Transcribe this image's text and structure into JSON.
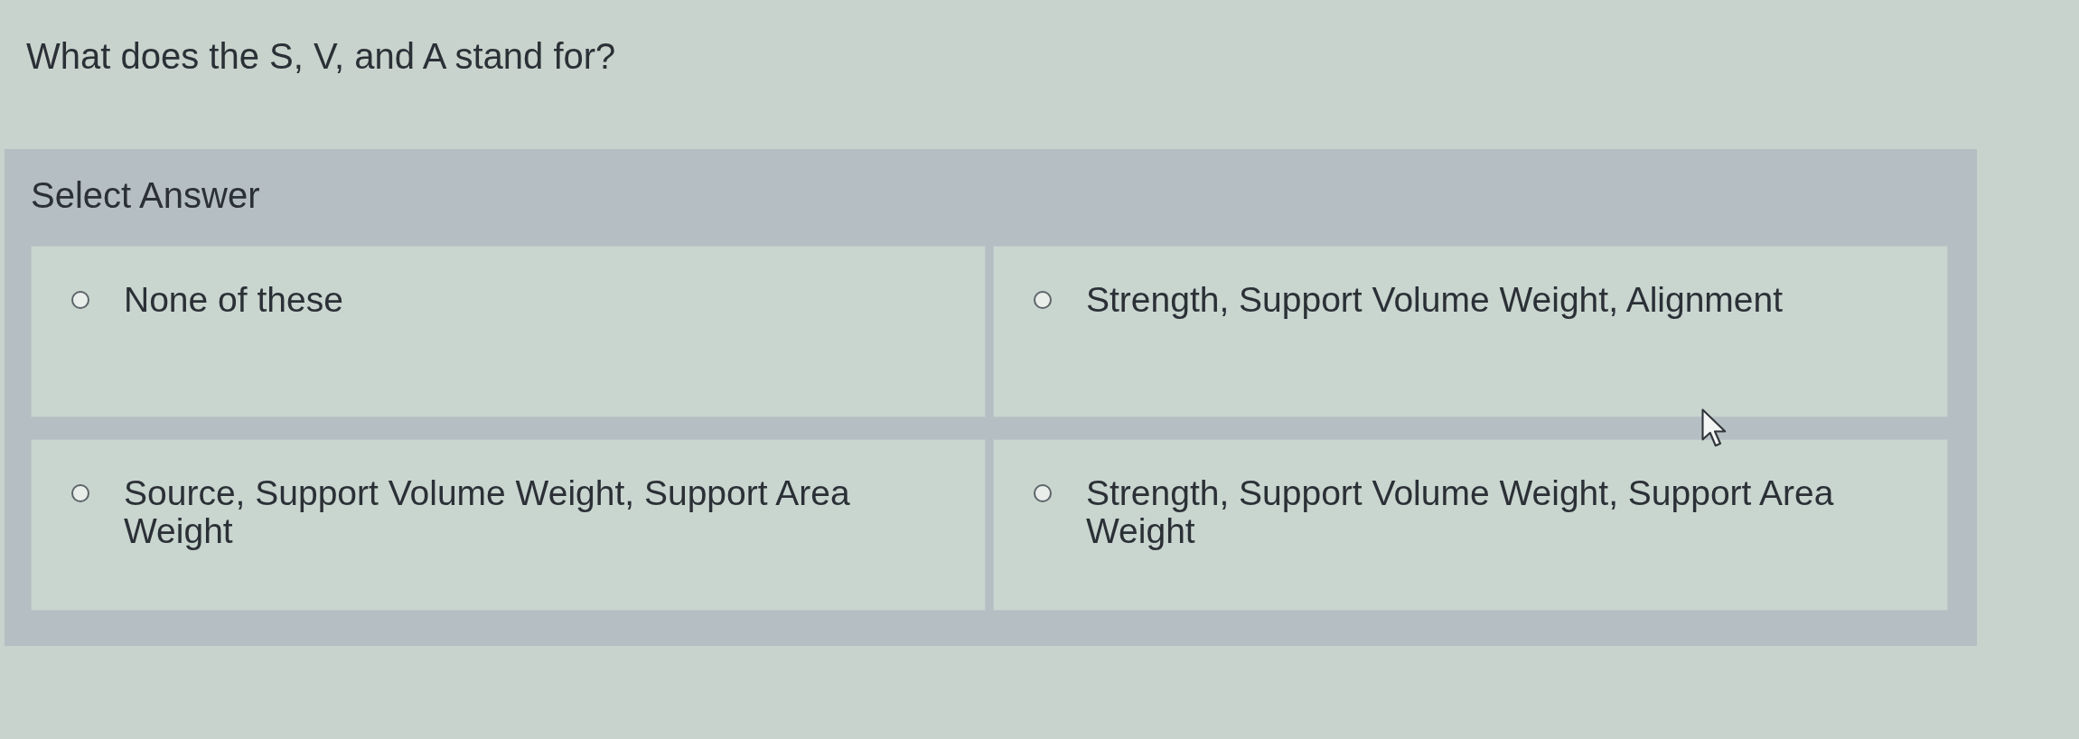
{
  "question": "What does the S, V, and A stand for?",
  "answer_panel": {
    "heading": "Select Answer",
    "options": [
      {
        "label": "None of these",
        "selected": false
      },
      {
        "label": "Strength, Support Volume Weight, Alignment",
        "selected": false
      },
      {
        "label": "Source, Support Volume Weight, Support Area Weight",
        "selected": false
      },
      {
        "label": "Strength, Support Volume Weight, Support Area Weight",
        "selected": false
      }
    ]
  }
}
